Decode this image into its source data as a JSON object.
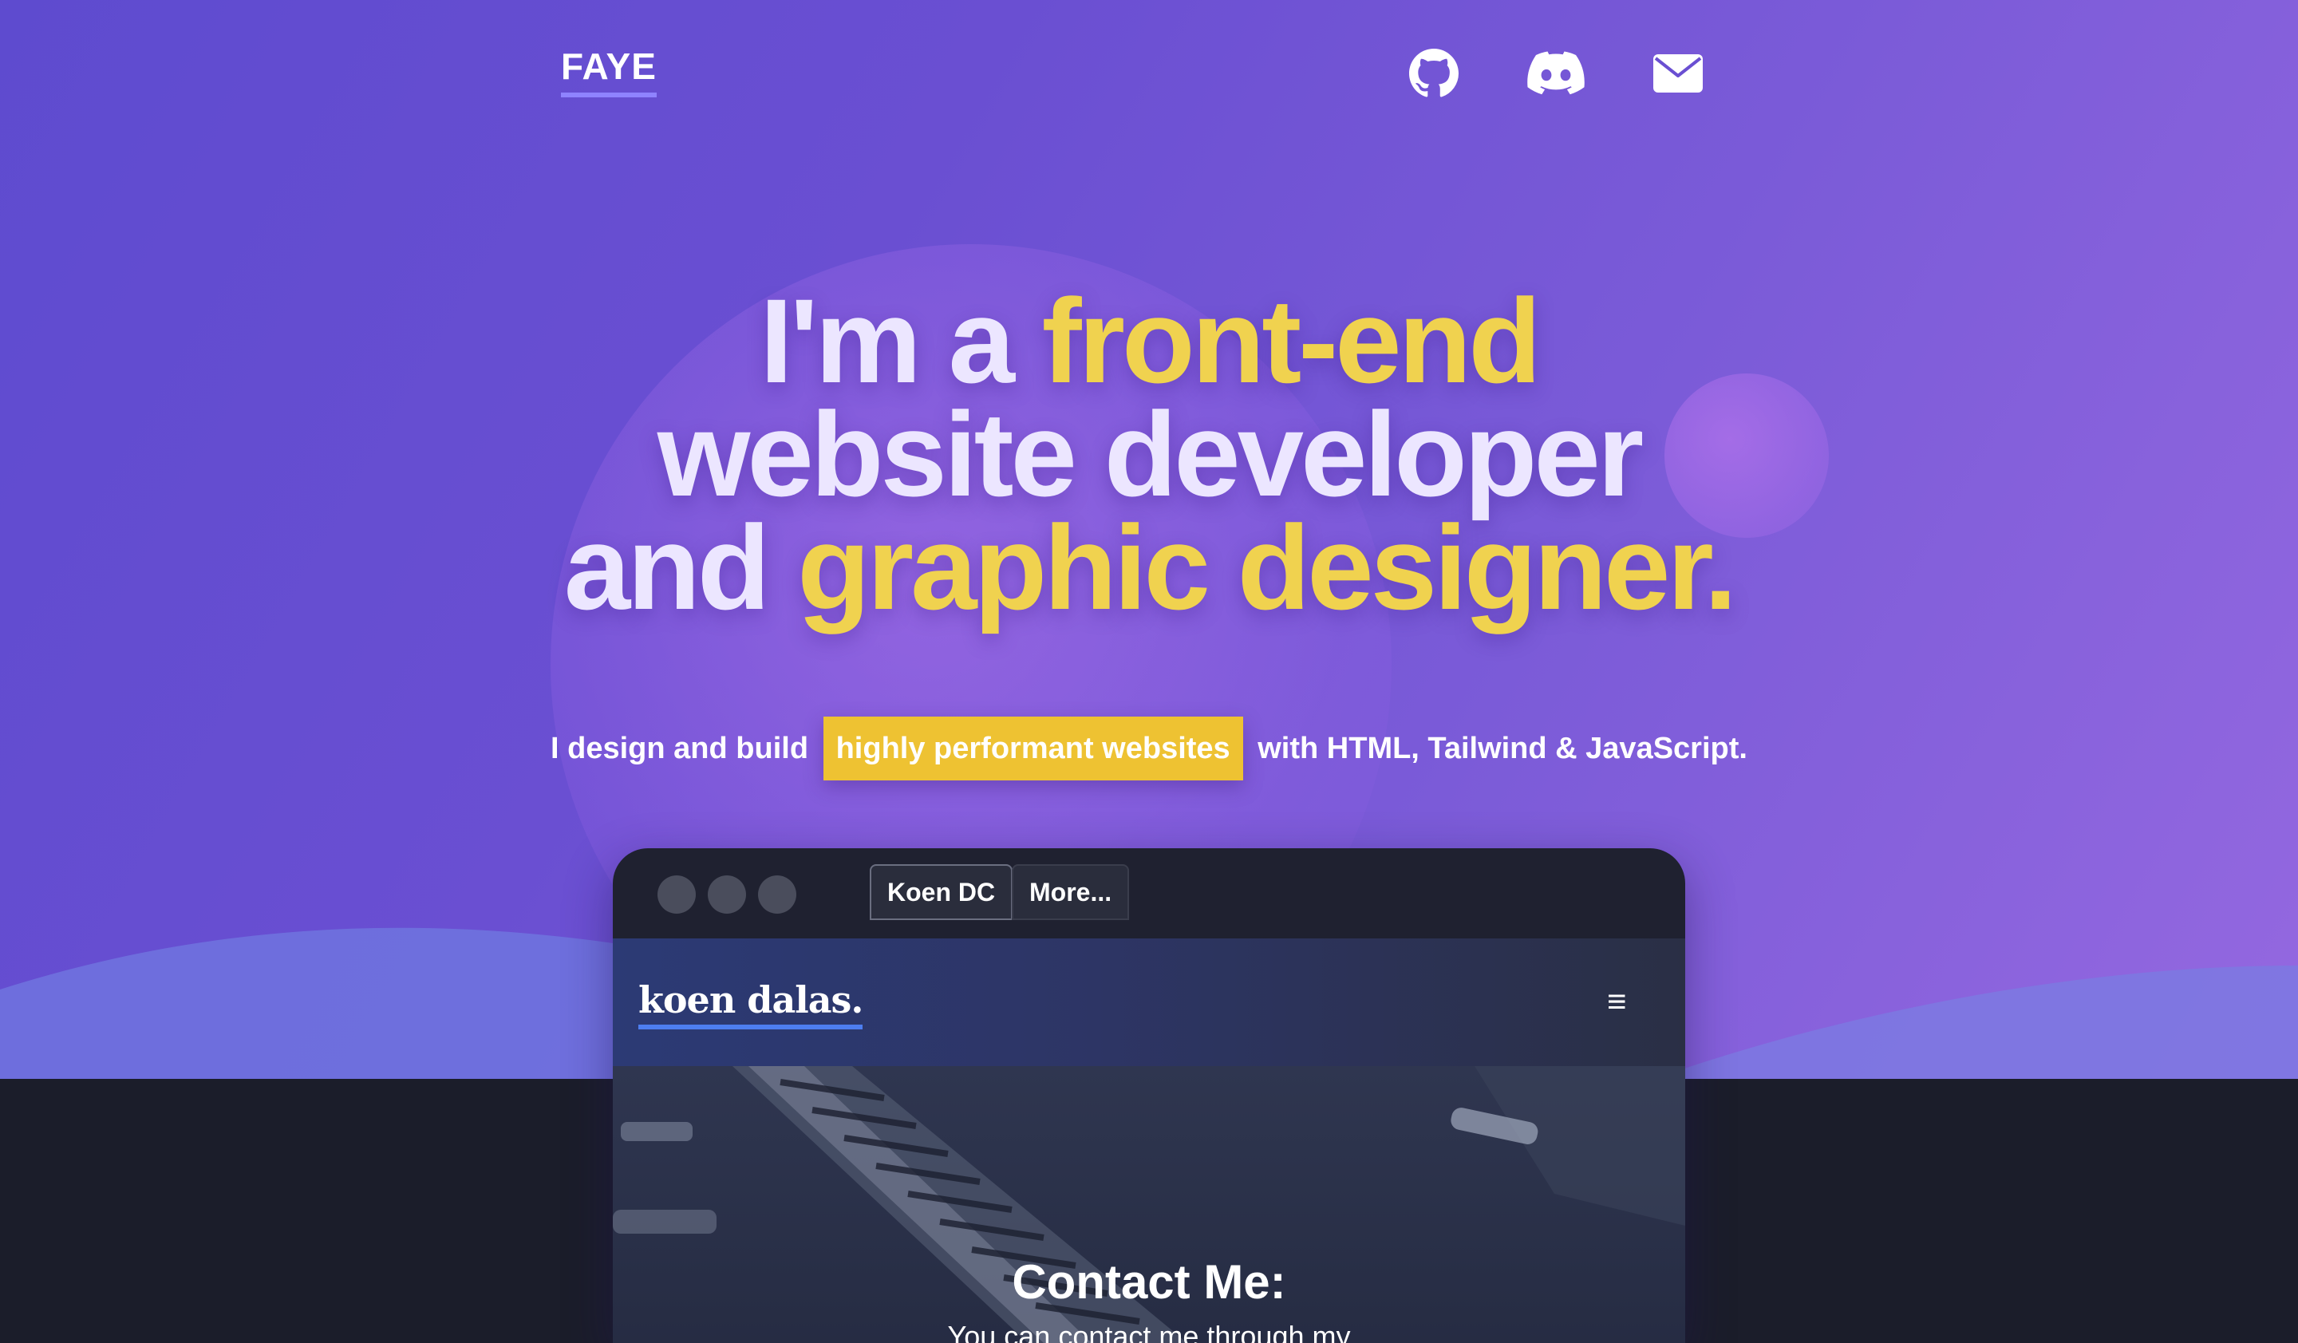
{
  "header": {
    "logo": "FAYE",
    "social": [
      {
        "icon": "github-icon",
        "label": "GitHub"
      },
      {
        "icon": "discord-icon",
        "label": "Discord"
      },
      {
        "icon": "mail-icon",
        "label": "Email"
      }
    ]
  },
  "hero": {
    "line1_prefix": "I'm a ",
    "line1_highlight": "front-end",
    "line2": "website developer",
    "line3_prefix": "and ",
    "line3_highlight": "graphic designer.",
    "tagline_prefix": "I design and build",
    "tagline_highlight": "highly performant websites",
    "tagline_suffix": "with HTML, Tailwind & JavaScript."
  },
  "preview": {
    "tabs": [
      "Koen DC",
      "More..."
    ],
    "active_tab": "Koen DC",
    "site_logo": "koen dalas.",
    "menu_icon": "≡",
    "contact_title": "Contact Me:",
    "contact_text": "You can contact me through my"
  },
  "colors": {
    "accent_yellow": "#f0d24f",
    "mark_yellow": "#eec232",
    "logo_underline": "#8f83ff",
    "site_logo_underline": "#4d7ef0",
    "dark_bg": "#1b1d2a"
  }
}
